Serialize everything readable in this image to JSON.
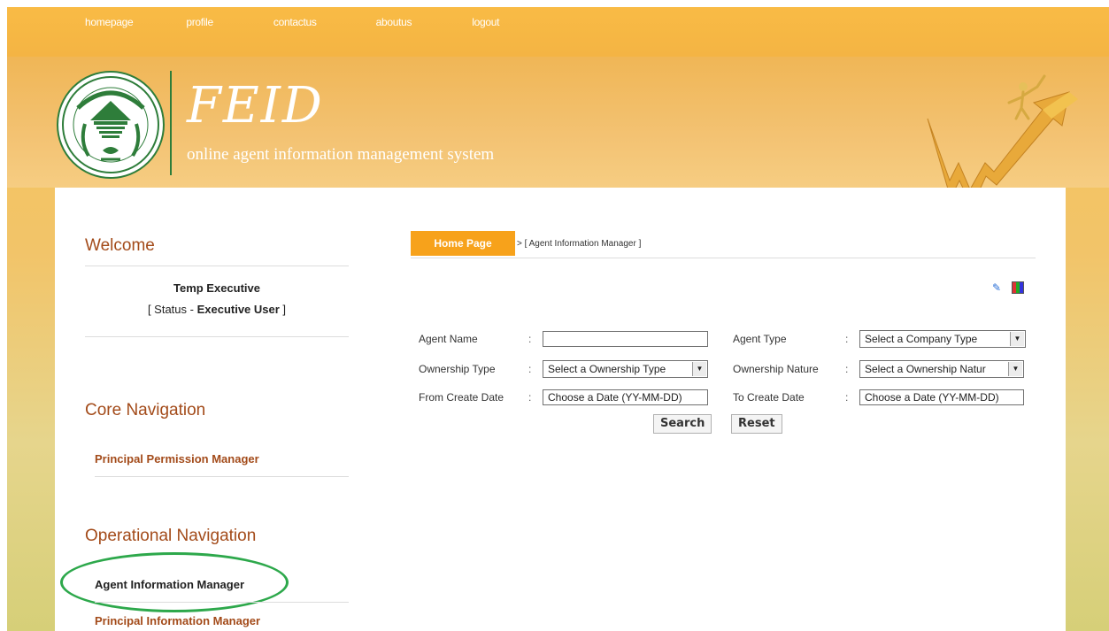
{
  "topnav": [
    "homepage",
    "profile",
    "contactus",
    "aboutus",
    "logout"
  ],
  "header": {
    "brand": "FEID",
    "tagline": "online agent information management system"
  },
  "sidebar": {
    "welcome_heading": "Welcome",
    "user_name": "Temp Executive",
    "status_prefix": "[ Status - ",
    "status_value": "Executive User",
    "status_suffix": " ]",
    "core_heading": "Core Navigation",
    "core_links": [
      "Principal Permission Manager"
    ],
    "operational_heading": "Operational Navigation",
    "operational_links": [
      "Agent Information Manager",
      "Principal Information Manager"
    ],
    "active_link": "Agent Information Manager"
  },
  "breadcrumb": {
    "home_label": "Home Page",
    "trail": "> [ Agent Information Manager ]"
  },
  "form": {
    "agent_name_label": "Agent Name",
    "agent_name_value": "",
    "agent_type_label": "Agent Type",
    "agent_type_selected": "Select a Company Type",
    "ownership_type_label": "Ownership Type",
    "ownership_type_selected": "Select a Ownership Type",
    "ownership_nature_label": "Ownership Nature",
    "ownership_nature_selected": "Select a Ownership Natur",
    "from_date_label": "From Create Date",
    "from_date_value": "Choose a Date (YY-MM-DD)",
    "to_date_label": "To Create Date",
    "to_date_value": "Choose a Date (YY-MM-DD)",
    "colon": ":",
    "search_label": "Search",
    "reset_label": "Reset"
  },
  "icons": {
    "edit": "edit-icon",
    "grid": "color-grid-icon",
    "logo": "bangladesh-bank-logo",
    "figure": "growth-chart-figure"
  },
  "colors": {
    "accent_orange": "#f7a21b",
    "heading_brown": "#a34b1a",
    "highlight_green": "#2da84b"
  }
}
